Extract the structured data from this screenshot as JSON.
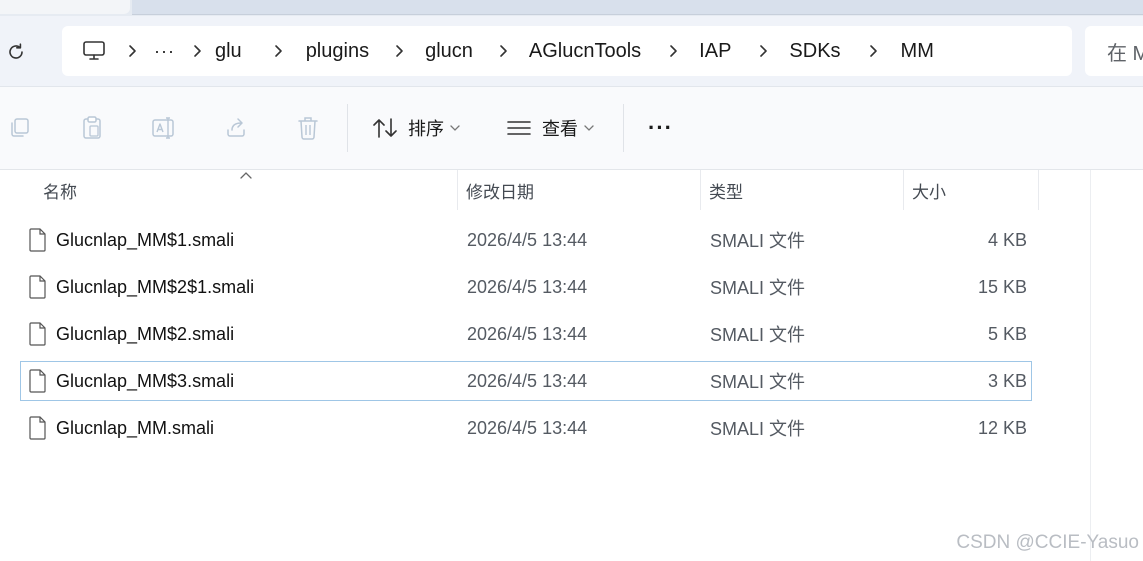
{
  "address": {
    "overflow_label": "···",
    "breadcrumbs": [
      "glu",
      "plugins",
      "glucn",
      "AGlucnTools",
      "IAP",
      "SDKs",
      "MM"
    ]
  },
  "search": {
    "placeholder": "在 MM 中搜索"
  },
  "toolbar": {
    "sort_label": "排序",
    "view_label": "查看",
    "more_label": "···"
  },
  "columns": {
    "name": "名称",
    "date": "修改日期",
    "type": "类型",
    "size": "大小"
  },
  "files": [
    {
      "name": "Glucnlap_MM$1.smali",
      "date": "2026/4/5 13:44",
      "type": "SMALI 文件",
      "size": "4 KB",
      "selected": false
    },
    {
      "name": "Glucnlap_MM$2$1.smali",
      "date": "2026/4/5 13:44",
      "type": "SMALI 文件",
      "size": "15 KB",
      "selected": false
    },
    {
      "name": "Glucnlap_MM$2.smali",
      "date": "2026/4/5 13:44",
      "type": "SMALI 文件",
      "size": "5 KB",
      "selected": false
    },
    {
      "name": "Glucnlap_MM$3.smali",
      "date": "2026/4/5 13:44",
      "type": "SMALI 文件",
      "size": "3 KB",
      "selected": true
    },
    {
      "name": "Glucnlap_MM.smali",
      "date": "2026/4/5 13:44",
      "type": "SMALI 文件",
      "size": "12 KB",
      "selected": false
    }
  ],
  "watermark": "CSDN @CCIE-Yasuo",
  "colors": {
    "selection_border": "#9fc6e6",
    "address_bg": "#f0f3f9",
    "toolbar_bg": "#f9fafc"
  },
  "icons": {
    "refresh": "refresh-icon",
    "computer": "computer-icon",
    "copy": "copy-icon",
    "paste": "paste-icon",
    "rename": "rename-icon",
    "share": "share-icon",
    "delete": "delete-icon",
    "sort": "sort-icon",
    "view": "view-icon",
    "file": "file-icon"
  }
}
